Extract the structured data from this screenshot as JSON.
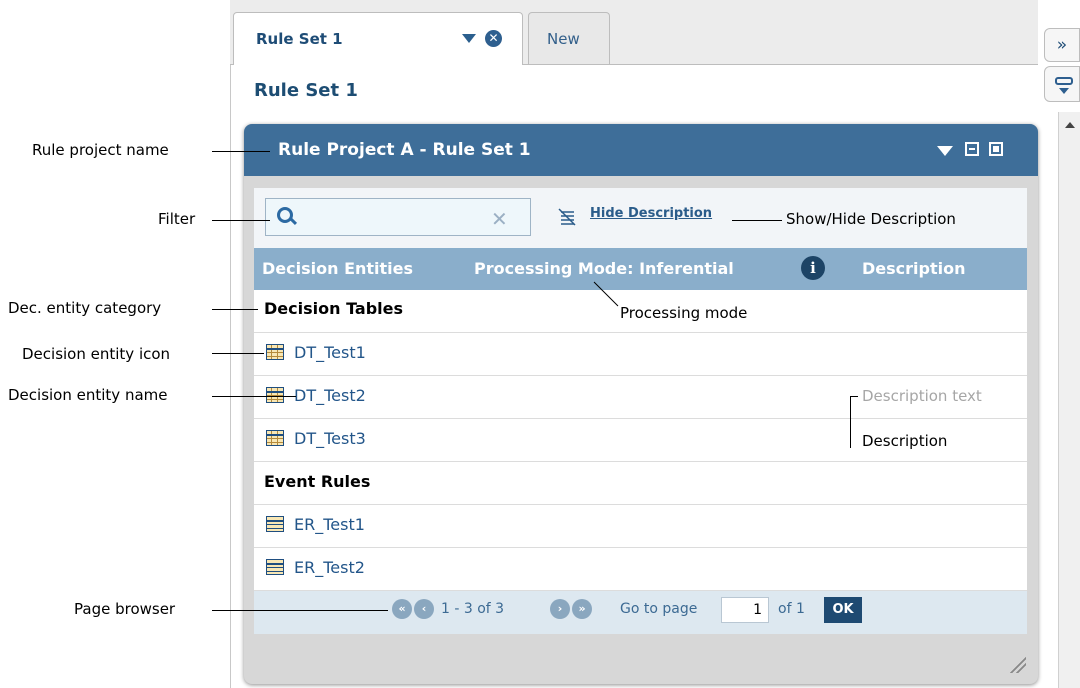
{
  "tabs": [
    {
      "label": "Rule Set 1",
      "active": true
    },
    {
      "label": "New",
      "active": false
    }
  ],
  "side_buttons": {
    "collapse_icon": "double-chevron-right-icon",
    "panel_icon": "panel-dropdown-icon"
  },
  "page_title": "Rule Set 1",
  "panel": {
    "title": "Rule Project A - Rule Set 1",
    "icons": [
      "dropdown-arrow-icon",
      "minimize-icon",
      "maximize-icon"
    ]
  },
  "filter": {
    "value": "",
    "hide_description_link": "Hide Description"
  },
  "columns": {
    "entities": "Decision Entities",
    "processing_mode": "Processing Mode: Inferential",
    "info_glyph": "i",
    "description": "Description"
  },
  "categories": [
    {
      "name": "Decision Tables",
      "items": [
        "DT_Test1",
        "DT_Test2",
        "DT_Test3"
      ]
    },
    {
      "name": "Event Rules",
      "items": [
        "ER_Test1",
        "ER_Test2"
      ]
    }
  ],
  "description_text": "Description text",
  "pager": {
    "range": "1 - 3 of 3",
    "goto_label": "Go to page",
    "page_value": "1",
    "of_label": "of 1",
    "ok_label": "OK"
  },
  "callouts": {
    "rule_project_name": "Rule project name",
    "filter": "Filter",
    "dec_entity_category": "Dec. entity category",
    "decision_entity_icon": "Decision entity icon",
    "decision_entity_name": "Decision entity name",
    "page_browser": "Page browser",
    "show_hide_description": "Show/Hide Description",
    "processing_mode": "Processing mode",
    "description": "Description"
  },
  "colors": {
    "header_blue": "#3e6e99",
    "column_header": "#8aaecb",
    "link_blue": "#23568a"
  }
}
